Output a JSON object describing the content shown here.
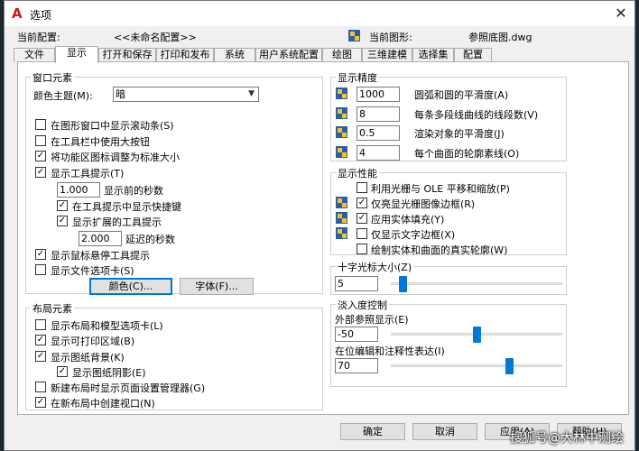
{
  "window": {
    "title": "选项",
    "close": "✕"
  },
  "profile": {
    "label": "当前配置:",
    "value": "<<未命名配置>>"
  },
  "drawing": {
    "label": "当前图形:",
    "value": "参照底图.dwg"
  },
  "tabs": [
    "文件",
    "显示",
    "打开和保存",
    "打印和发布",
    "系统",
    "用户系统配置",
    "绘图",
    "三维建模",
    "选择集",
    "配置"
  ],
  "window_elements": {
    "title": "窗口元素",
    "theme_label": "颜色主题(M):",
    "theme_value": "暗",
    "options": [
      {
        "label": "在图形窗口中显示滚动条(S)",
        "checked": false
      },
      {
        "label": "在工具栏中使用大按钮",
        "checked": false
      },
      {
        "label": "将功能区图标调整为标准大小",
        "checked": true
      },
      {
        "label": "显示工具提示(T)",
        "checked": true
      }
    ],
    "tooltip_delay": {
      "value": "1.000",
      "label": "显示前的秒数"
    },
    "sub_options": [
      {
        "label": "在工具提示中显示快捷键",
        "checked": true
      },
      {
        "label": "显示扩展的工具提示",
        "checked": true
      }
    ],
    "ext_delay": {
      "value": "2.000",
      "label": "延迟的秒数"
    },
    "options2": [
      {
        "label": "显示鼠标悬停工具提示",
        "checked": true
      },
      {
        "label": "显示文件选项卡(S)",
        "checked": false
      }
    ],
    "colors_button": "颜色(C)...",
    "fonts_button": "字体(F)..."
  },
  "layout_elements": {
    "title": "布局元素",
    "options": [
      {
        "label": "显示布局和模型选项卡(L)",
        "checked": false
      },
      {
        "label": "显示可打印区域(B)",
        "checked": true
      },
      {
        "label": "显示图纸背景(K)",
        "checked": true
      }
    ],
    "shadow": {
      "label": "显示图纸阴影(E)",
      "checked": true
    },
    "options2": [
      {
        "label": "新建布局时显示页面设置管理器(G)",
        "checked": false
      },
      {
        "label": "在新布局中创建视口(N)",
        "checked": true
      }
    ]
  },
  "resolution": {
    "title": "显示精度",
    "rows": [
      {
        "value": "1000",
        "label": "圆弧和圆的平滑度(A)"
      },
      {
        "value": "8",
        "label": "每条多段线曲线的线段数(V)"
      },
      {
        "value": "0.5",
        "label": "渲染对象的平滑度(J)"
      },
      {
        "value": "4",
        "label": "每个曲面的轮廓素线(O)"
      }
    ]
  },
  "performance": {
    "title": "显示性能",
    "options": [
      {
        "label": "利用光栅与 OLE 平移和缩放(P)",
        "checked": false
      },
      {
        "label": "仅亮显光栅图像边框(R)",
        "checked": true
      },
      {
        "label": "应用实体填充(Y)",
        "checked": true
      },
      {
        "label": "仅显示文字边框(X)",
        "checked": false
      },
      {
        "label": "绘制实体和曲面的真实轮廓(W)",
        "checked": false
      }
    ]
  },
  "crosshair": {
    "title": "十字光标大小(Z)",
    "value": "5",
    "level_fraction": 0.05
  },
  "fade": {
    "title": "淡入度控制",
    "xref": {
      "label": "外部参照显示(E)",
      "value": "-50",
      "level_fraction": 0.5
    },
    "inplace": {
      "label": "在位编辑和注释性表达(I)",
      "value": "70",
      "level_fraction": 0.7
    }
  },
  "buttons": {
    "ok": "确定",
    "cancel": "取消",
    "apply": "应用(A)",
    "help": "帮助(H)"
  },
  "watermark": "搜狐号@大林中测绘",
  "colors": {
    "accent": "#0078d7",
    "title_icon": "#d01818"
  }
}
